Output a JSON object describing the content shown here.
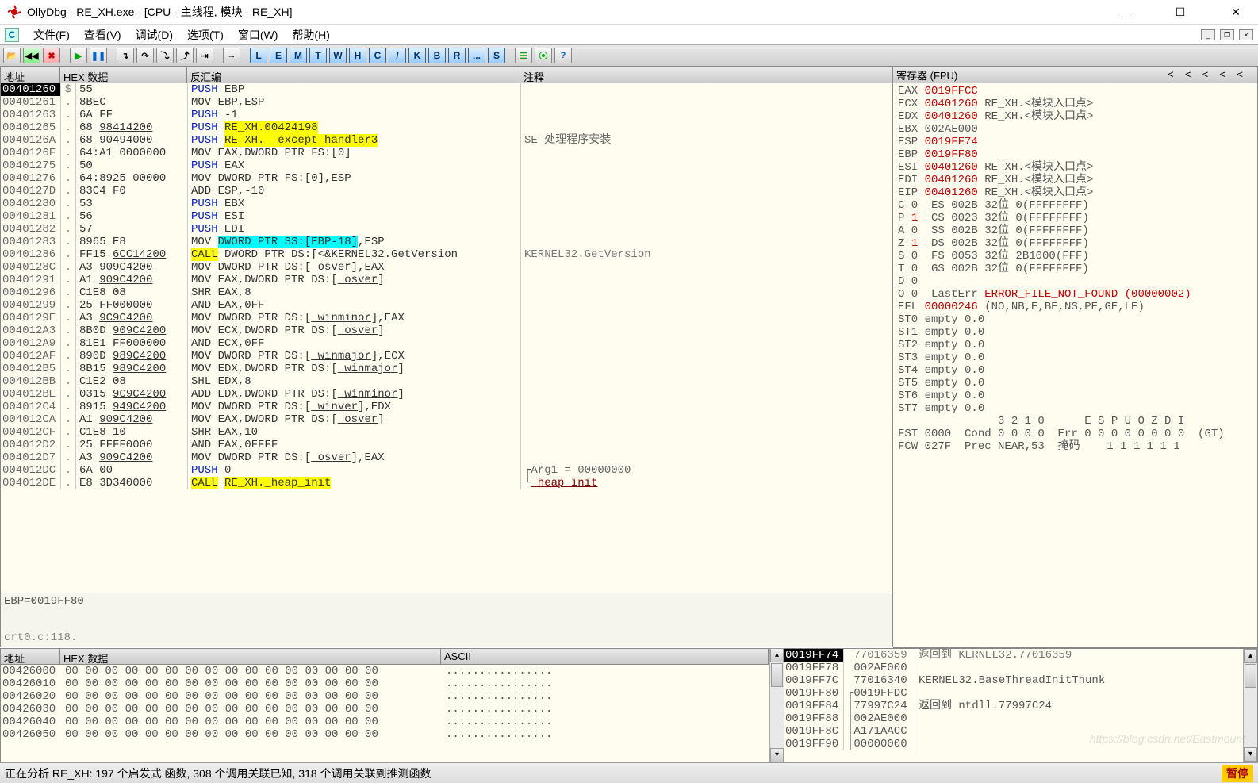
{
  "title": "OllyDbg - RE_XH.exe - [CPU - 主线程, 模块 - RE_XH]",
  "menu": {
    "file": "文件(F)",
    "view": "查看(V)",
    "debug": "调试(D)",
    "options": "选项(T)",
    "window": "窗口(W)",
    "help": "帮助(H)"
  },
  "letters": [
    "L",
    "E",
    "M",
    "T",
    "W",
    "H",
    "C",
    "/",
    "K",
    "B",
    "R",
    "...",
    "S"
  ],
  "cols": {
    "addr": "地址",
    "hex": "HEX 数据",
    "dis": "反汇编",
    "cmt": "注释"
  },
  "disasm": [
    {
      "a": "00401260",
      "g": "$",
      "h": "55",
      "d": [
        [
          "blue",
          "PUSH"
        ],
        [
          "txt",
          " EBP"
        ]
      ],
      "sel": true
    },
    {
      "a": "00401261",
      "g": ".",
      "h": "8BEC",
      "d": [
        [
          "txt",
          "MOV EBP,ESP"
        ]
      ]
    },
    {
      "a": "00401263",
      "g": ".",
      "h": "6A FF",
      "d": [
        [
          "blue",
          "PUSH"
        ],
        [
          "txt",
          " -1"
        ]
      ]
    },
    {
      "a": "00401265",
      "g": ".",
      "h": "68 ",
      "hu": "98414200",
      "d": [
        [
          "blue",
          "PUSH"
        ],
        [
          "txt",
          " "
        ],
        [
          "yel",
          "RE_XH.00424198"
        ]
      ]
    },
    {
      "a": "0040126A",
      "g": ".",
      "h": "68 ",
      "hu": "90494000",
      "d": [
        [
          "blue",
          "PUSH"
        ],
        [
          "txt",
          " "
        ],
        [
          "yel",
          "RE_XH.__except_handler3"
        ]
      ],
      "c": "SE 处理程序安装"
    },
    {
      "a": "0040126F",
      "g": ".",
      "h": "64:A1 0000000",
      "d": [
        [
          "txt",
          "MOV EAX,DWORD PTR FS:[0]"
        ]
      ]
    },
    {
      "a": "00401275",
      "g": ".",
      "h": "50",
      "d": [
        [
          "blue",
          "PUSH"
        ],
        [
          "txt",
          " EAX"
        ]
      ]
    },
    {
      "a": "00401276",
      "g": ".",
      "h": "64:8925 00000",
      "d": [
        [
          "txt",
          "MOV DWORD PTR FS:[0],ESP"
        ]
      ]
    },
    {
      "a": "0040127D",
      "g": ".",
      "h": "83C4 F0",
      "d": [
        [
          "txt",
          "ADD ESP,-10"
        ]
      ]
    },
    {
      "a": "00401280",
      "g": ".",
      "h": "53",
      "d": [
        [
          "blue",
          "PUSH"
        ],
        [
          "txt",
          " EBX"
        ]
      ]
    },
    {
      "a": "00401281",
      "g": ".",
      "h": "56",
      "d": [
        [
          "blue",
          "PUSH"
        ],
        [
          "txt",
          " ESI"
        ]
      ]
    },
    {
      "a": "00401282",
      "g": ".",
      "h": "57",
      "d": [
        [
          "blue",
          "PUSH"
        ],
        [
          "txt",
          " EDI"
        ]
      ]
    },
    {
      "a": "00401283",
      "g": ".",
      "h": "8965 E8",
      "d": [
        [
          "txt",
          "MOV "
        ],
        [
          "cyan",
          "DWORD PTR SS:[EBP-18]"
        ],
        [
          "txt",
          ",ESP"
        ]
      ]
    },
    {
      "a": "00401286",
      "g": ".",
      "h": "FF15 ",
      "hu": "6CC14200",
      "d": [
        [
          "yelc",
          "CALL"
        ],
        [
          "txt",
          " DWORD PTR DS:[<&KERNEL32.GetVersion"
        ]
      ],
      "c": "KERNEL32.GetVersion",
      "cgray": true
    },
    {
      "a": "0040128C",
      "g": ".",
      "h": "A3 ",
      "hu": "909C4200",
      "d": [
        [
          "txt",
          "MOV DWORD PTR DS:["
        ],
        [
          "u",
          "_osver"
        ],
        [
          "txt",
          "],EAX"
        ]
      ]
    },
    {
      "a": "00401291",
      "g": ".",
      "h": "A1 ",
      "hu": "909C4200",
      "d": [
        [
          "txt",
          "MOV EAX,DWORD PTR DS:["
        ],
        [
          "u",
          "_osver"
        ],
        [
          "txt",
          "]"
        ]
      ]
    },
    {
      "a": "00401296",
      "g": ".",
      "h": "C1E8 08",
      "d": [
        [
          "txt",
          "SHR EAX,8"
        ]
      ]
    },
    {
      "a": "00401299",
      "g": ".",
      "h": "25 FF000000",
      "d": [
        [
          "txt",
          "AND EAX,0FF"
        ]
      ]
    },
    {
      "a": "0040129E",
      "g": ".",
      "h": "A3 ",
      "hu": "9C9C4200",
      "d": [
        [
          "txt",
          "MOV DWORD PTR DS:["
        ],
        [
          "u",
          "_winminor"
        ],
        [
          "txt",
          "],EAX"
        ]
      ]
    },
    {
      "a": "004012A3",
      "g": ".",
      "h": "8B0D ",
      "hu": "909C4200",
      "d": [
        [
          "txt",
          "MOV ECX,DWORD PTR DS:["
        ],
        [
          "u",
          "_osver"
        ],
        [
          "txt",
          "]"
        ]
      ]
    },
    {
      "a": "004012A9",
      "g": ".",
      "h": "81E1 FF000000",
      "d": [
        [
          "txt",
          "AND ECX,0FF"
        ]
      ]
    },
    {
      "a": "004012AF",
      "g": ".",
      "h": "890D ",
      "hu": "989C4200",
      "d": [
        [
          "txt",
          "MOV DWORD PTR DS:["
        ],
        [
          "u",
          "_winmajor"
        ],
        [
          "txt",
          "],ECX"
        ]
      ]
    },
    {
      "a": "004012B5",
      "g": ".",
      "h": "8B15 ",
      "hu": "989C4200",
      "d": [
        [
          "txt",
          "MOV EDX,DWORD PTR DS:["
        ],
        [
          "u",
          "_winmajor"
        ],
        [
          "txt",
          "]"
        ]
      ]
    },
    {
      "a": "004012BB",
      "g": ".",
      "h": "C1E2 08",
      "d": [
        [
          "txt",
          "SHL EDX,8"
        ]
      ]
    },
    {
      "a": "004012BE",
      "g": ".",
      "h": "0315 ",
      "hu": "9C9C4200",
      "d": [
        [
          "txt",
          "ADD EDX,DWORD PTR DS:["
        ],
        [
          "u",
          "_winminor"
        ],
        [
          "txt",
          "]"
        ]
      ]
    },
    {
      "a": "004012C4",
      "g": ".",
      "h": "8915 ",
      "hu": "949C4200",
      "d": [
        [
          "txt",
          "MOV DWORD PTR DS:["
        ],
        [
          "u",
          "_winver"
        ],
        [
          "txt",
          "],EDX"
        ]
      ]
    },
    {
      "a": "004012CA",
      "g": ".",
      "h": "A1 ",
      "hu": "909C4200",
      "d": [
        [
          "txt",
          "MOV EAX,DWORD PTR DS:["
        ],
        [
          "u",
          "_osver"
        ],
        [
          "txt",
          "]"
        ]
      ]
    },
    {
      "a": "004012CF",
      "g": ".",
      "h": "C1E8 10",
      "d": [
        [
          "txt",
          "SHR EAX,10"
        ]
      ]
    },
    {
      "a": "004012D2",
      "g": ".",
      "h": "25 FFFF0000",
      "d": [
        [
          "txt",
          "AND EAX,0FFFF"
        ]
      ]
    },
    {
      "a": "004012D7",
      "g": ".",
      "h": "A3 ",
      "hu": "909C4200",
      "d": [
        [
          "txt",
          "MOV DWORD PTR DS:["
        ],
        [
          "u",
          "_osver"
        ],
        [
          "txt",
          "],EAX"
        ]
      ]
    },
    {
      "a": "004012DC",
      "g": ".",
      "h": "6A 00",
      "d": [
        [
          "blue",
          "PUSH"
        ],
        [
          "txt",
          " 0"
        ]
      ],
      "c": "┌Arg1 = 00000000",
      "br": true
    },
    {
      "a": "004012DE",
      "g": ".",
      "h": "E8 3D340000",
      "d": [
        [
          "yelc",
          "CALL"
        ],
        [
          "txt",
          " "
        ],
        [
          "yel",
          "RE_XH._heap_init"
        ]
      ],
      "c": "└",
      "c2": "_heap_init",
      "cred": true,
      "br": true
    }
  ],
  "info": {
    "l1": "EBP=0019FF80",
    "l2": "crt0.c:118."
  },
  "reghdr": "寄存器 (FPU)",
  "regs": [
    [
      [
        "txt",
        "EAX "
      ],
      [
        "red",
        "0019FFCC"
      ]
    ],
    [
      [
        "txt",
        "ECX "
      ],
      [
        "red",
        "00401260"
      ],
      [
        "txt",
        " RE_XH.<模块入口点>"
      ]
    ],
    [
      [
        "txt",
        "EDX "
      ],
      [
        "red",
        "00401260"
      ],
      [
        "txt",
        " RE_XH.<模块入口点>"
      ]
    ],
    [
      [
        "txt",
        "EBX 002AE000"
      ]
    ],
    [
      [
        "txt",
        "ESP "
      ],
      [
        "red",
        "0019FF74"
      ]
    ],
    [
      [
        "txt",
        "EBP "
      ],
      [
        "red",
        "0019FF80"
      ]
    ],
    [
      [
        "txt",
        "ESI "
      ],
      [
        "red",
        "00401260"
      ],
      [
        "txt",
        " RE_XH.<模块入口点>"
      ]
    ],
    [
      [
        "txt",
        "EDI "
      ],
      [
        "red",
        "00401260"
      ],
      [
        "txt",
        " RE_XH.<模块入口点>"
      ]
    ],
    [
      [
        "txt",
        ""
      ]
    ],
    [
      [
        "txt",
        "EIP "
      ],
      [
        "red",
        "00401260"
      ],
      [
        "txt",
        " RE_XH.<模块入口点>"
      ]
    ],
    [
      [
        "txt",
        ""
      ]
    ],
    [
      [
        "txt",
        "C 0  ES 002B 32位 0(FFFFFFFF)"
      ]
    ],
    [
      [
        "txt",
        "P "
      ],
      [
        "red",
        "1"
      ],
      [
        "txt",
        "  CS 0023 32位 0(FFFFFFFF)"
      ]
    ],
    [
      [
        "txt",
        "A 0  SS 002B 32位 0(FFFFFFFF)"
      ]
    ],
    [
      [
        "txt",
        "Z "
      ],
      [
        "red",
        "1"
      ],
      [
        "txt",
        "  DS 002B 32位 0(FFFFFFFF)"
      ]
    ],
    [
      [
        "txt",
        "S 0  FS 0053 32位 2B1000(FFF)"
      ]
    ],
    [
      [
        "txt",
        "T 0  GS 002B 32位 0(FFFFFFFF)"
      ]
    ],
    [
      [
        "txt",
        "D 0"
      ]
    ],
    [
      [
        "txt",
        "O 0  LastErr "
      ],
      [
        "red",
        "ERROR_FILE_NOT_FOUND (00000002)"
      ]
    ],
    [
      [
        "txt",
        ""
      ]
    ],
    [
      [
        "txt",
        "EFL "
      ],
      [
        "red",
        "00000246"
      ],
      [
        "txt",
        " (NO,NB,E,BE,NS,PE,GE,LE)"
      ]
    ],
    [
      [
        "txt",
        ""
      ]
    ],
    [
      [
        "txt",
        "ST0 empty 0.0"
      ]
    ],
    [
      [
        "txt",
        "ST1 empty 0.0"
      ]
    ],
    [
      [
        "txt",
        "ST2 empty 0.0"
      ]
    ],
    [
      [
        "txt",
        "ST3 empty 0.0"
      ]
    ],
    [
      [
        "txt",
        "ST4 empty 0.0"
      ]
    ],
    [
      [
        "txt",
        "ST5 empty 0.0"
      ]
    ],
    [
      [
        "txt",
        "ST6 empty 0.0"
      ]
    ],
    [
      [
        "txt",
        "ST7 empty 0.0"
      ]
    ],
    [
      [
        "txt",
        "               3 2 1 0      E S P U O Z D I"
      ]
    ],
    [
      [
        "txt",
        "FST 0000  Cond 0 0 0 0  Err 0 0 0 0 0 0 0 0  (GT)"
      ]
    ],
    [
      [
        "txt",
        "FCW 027F  Prec NEAR,53  掩码    1 1 1 1 1 1"
      ]
    ]
  ],
  "dumphdr": {
    "addr": "地址",
    "hex": "HEX 数据",
    "asc": "ASCII"
  },
  "dump": [
    {
      "a": "00426000",
      "h": "00 00 00 00 00 00 00 00 00 00 00 00 00 00 00 00",
      "s": "................"
    },
    {
      "a": "00426010",
      "h": "00 00 00 00 00 00 00 00 00 00 00 00 00 00 00 00",
      "s": "................"
    },
    {
      "a": "00426020",
      "h": "00 00 00 00 00 00 00 00 00 00 00 00 00 00 00 00",
      "s": "................"
    },
    {
      "a": "00426030",
      "h": "00 00 00 00 00 00 00 00 00 00 00 00 00 00 00 00",
      "s": "................"
    },
    {
      "a": "00426040",
      "h": "00 00 00 00 00 00 00 00 00 00 00 00 00 00 00 00",
      "s": "................"
    },
    {
      "a": "00426050",
      "h": "00 00 00 00 00 00 00 00 00 00 00 00 00 00 00 00",
      "s": "................"
    }
  ],
  "stack": [
    {
      "a": "0019FF74",
      "v": "77016359",
      "c": "返回到 KERNEL32.77016359",
      "sel": true,
      "g": true
    },
    {
      "a": "0019FF78",
      "v": "002AE000",
      "c": ""
    },
    {
      "a": "0019FF7C",
      "v": "77016340",
      "c": "KERNEL32.BaseThreadInitThunk"
    },
    {
      "a": "0019FF80",
      "v": "0019FFDC",
      "c": "",
      "br": "┌"
    },
    {
      "a": "0019FF84",
      "v": "77997C24",
      "c": "返回到 ntdll.77997C24",
      "br": "│"
    },
    {
      "a": "0019FF88",
      "v": "002AE000",
      "c": "",
      "br": "│"
    },
    {
      "a": "0019FF8C",
      "v": "A171AACC",
      "c": "",
      "br": "│"
    },
    {
      "a": "0019FF90",
      "v": "00000000",
      "c": "",
      "br": "│"
    }
  ],
  "status": "正在分析 RE_XH: 197 个启发式 函数, 308 个调用关联已知, 318 个调用关联到推测函数",
  "status_right": "暂停",
  "watermark": "https://blog.csdn.net/Eastmount"
}
